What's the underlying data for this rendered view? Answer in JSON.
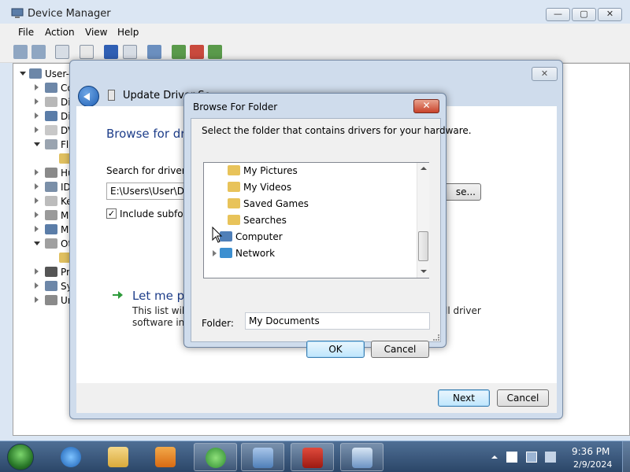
{
  "device_manager": {
    "title": "Device Manager",
    "menu": [
      "File",
      "Action",
      "View",
      "Help"
    ],
    "caption_buttons": {
      "minimize": "—",
      "maximize": "▢",
      "close": "✕"
    },
    "tree_root": "User-PC",
    "tree_items": [
      "Computer",
      "Disk drives",
      "Display adapters",
      "DVD/CD-ROM drives",
      "Floppy disk drives",
      "",
      "Human Interface Devices",
      "IDE ATA/ATAPI controllers",
      "Keyboards",
      "Mice and other pointing devices",
      "Monitors",
      "Other devices",
      "",
      "Processors",
      "System devices",
      "Universal Serial Bus controllers"
    ],
    "tree_visible": [
      "User-I",
      "Co",
      "Di",
      "Di",
      "DV",
      "Fl",
      "",
      "Hu",
      "ID",
      "Ke",
      "Mi",
      "Mo",
      "Ot",
      "",
      "Pr",
      "Sy",
      "Ur"
    ]
  },
  "wizard": {
    "title": "Update Driver So",
    "close": "✕",
    "heading": "Browse for dri",
    "search_label": "Search for driver so",
    "path_value": "E:\\Users\\User\\Doc",
    "browse_label": "se...",
    "include_subfolders_checked": true,
    "include_subfolders_label": "Include subfold",
    "pick_title": "Let me pi",
    "pick_desc_line1": "This list will s",
    "pick_desc_line1_tail": "ll driver",
    "pick_desc_line2": "software in t",
    "next": "Next",
    "cancel": "Cancel"
  },
  "browse_for_folder": {
    "title": "Browse For Folder",
    "close": "✕",
    "instruction": "Select the folder that contains drivers for your hardware.",
    "folders": [
      {
        "label": "My Pictures",
        "icon": "pictures-folder-icon"
      },
      {
        "label": "My Videos",
        "icon": "videos-folder-icon"
      },
      {
        "label": "Saved Games",
        "icon": "saved-games-folder-icon"
      },
      {
        "label": "Searches",
        "icon": "searches-folder-icon"
      },
      {
        "label": "Computer",
        "icon": "computer-icon"
      },
      {
        "label": "Network",
        "icon": "network-icon"
      }
    ],
    "folder_label": "Folder:",
    "folder_value": "My Documents",
    "ok": "OK",
    "cancel": "Cancel"
  },
  "taskbar": {
    "time": "9:36 PM",
    "date": "2/9/2024"
  }
}
